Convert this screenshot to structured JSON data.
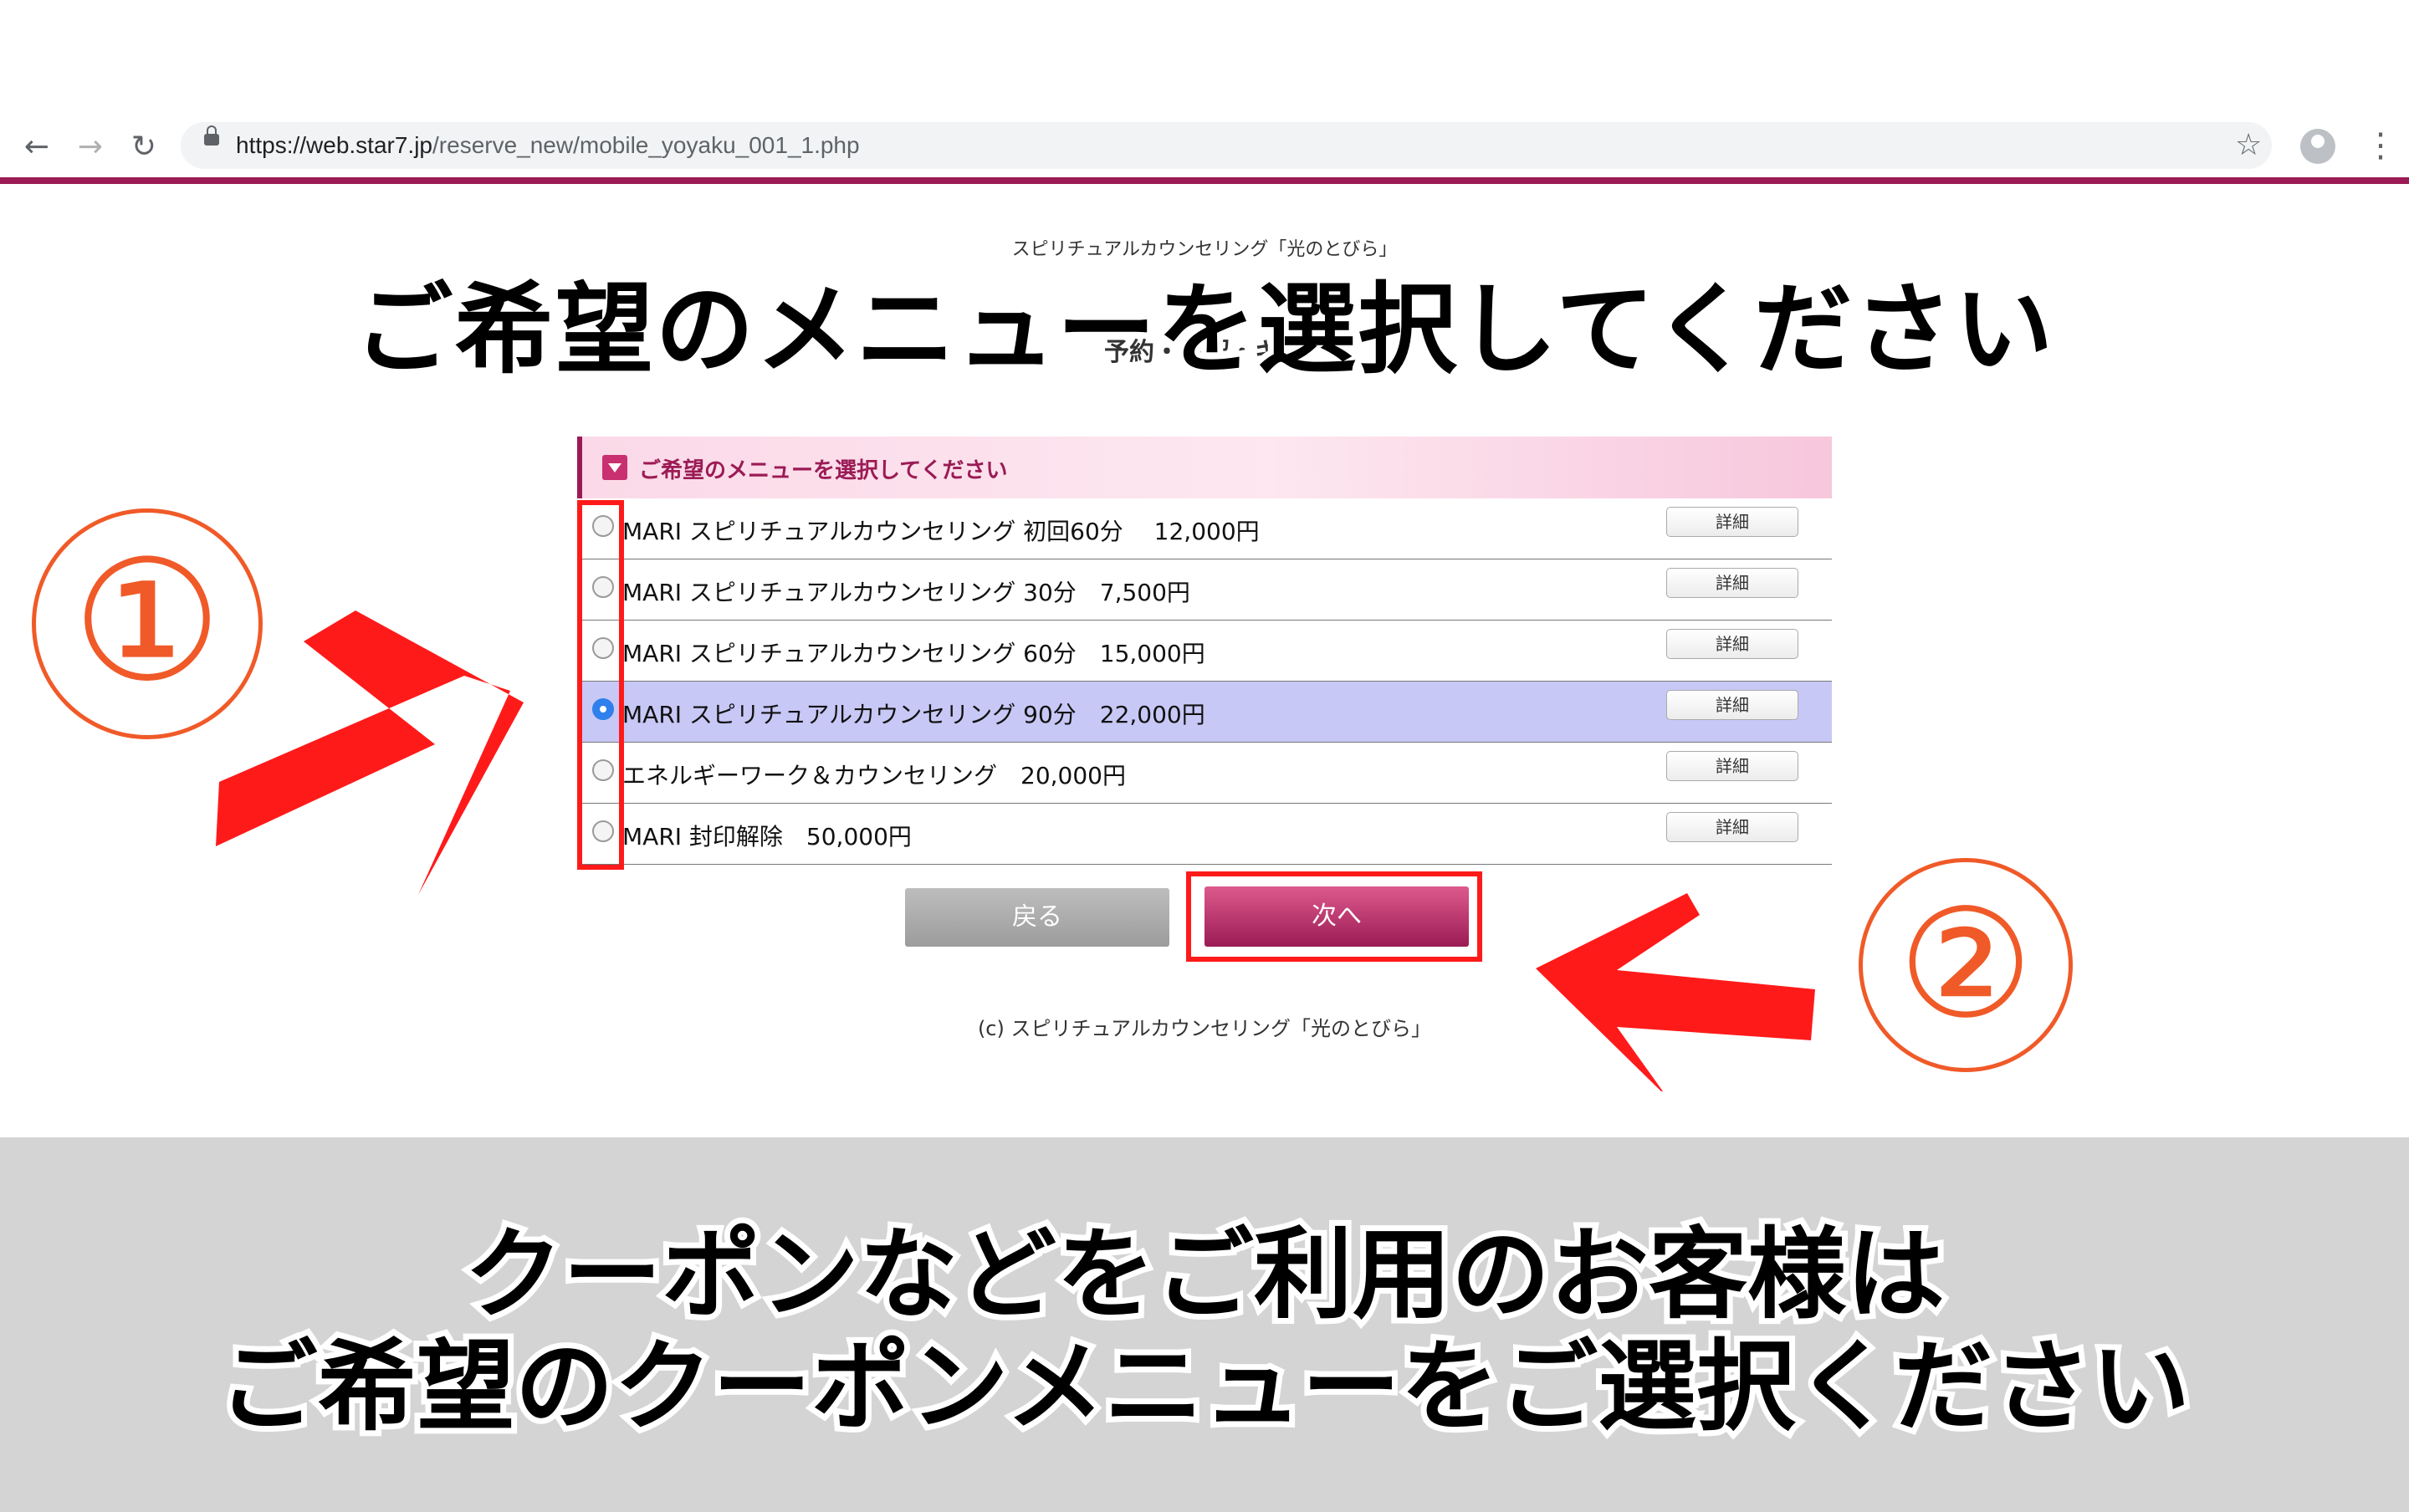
{
  "browser": {
    "url_host": "https://web.star7.jp",
    "url_path": "/reserve_new/mobile_yoyaku_001_1.php",
    "back_icon": "arrow-left-icon",
    "forward_icon": "arrow-right-icon",
    "reload_icon": "reload-icon",
    "bookmark_icon": "star-icon",
    "menu_icon": "kebab-icon",
    "accent_color": "#9b1b55"
  },
  "site": {
    "title": "スピリチュアルカウンセリング「光のとびら」",
    "steps": "予約・確認・キャ"
  },
  "overlay": {
    "title": "ご希望のメニューを選択してください",
    "marker1": "①",
    "marker2": "②"
  },
  "menu": {
    "header": "ご希望のメニューを選択してください",
    "items": [
      {
        "label": "MARI スピリチュアルカウンセリング 初回60分　 12,000円",
        "detail": "詳細",
        "selected": false
      },
      {
        "label": "MARI スピリチュアルカウンセリング 30分　7,500円",
        "detail": "詳細",
        "selected": false
      },
      {
        "label": "MARI スピリチュアルカウンセリング 60分　15,000円",
        "detail": "詳細",
        "selected": false
      },
      {
        "label": "MARI スピリチュアルカウンセリング 90分　22,000円",
        "detail": "詳細",
        "selected": true
      },
      {
        "label": "エネルギーワーク＆カウンセリング　20,000円",
        "detail": "詳細",
        "selected": false
      },
      {
        "label": "MARI 封印解除　50,000円",
        "detail": "詳細",
        "selected": false
      }
    ]
  },
  "buttons": {
    "back": "戻る",
    "next": "次へ"
  },
  "footer": {
    "copyright": "(c)  スピリチュアルカウンセリング「光のとびら」"
  },
  "banner": {
    "line1": "クーポンなどをご利用のお客様は",
    "line2": "ご希望のクーポンメニューをご選択ください"
  }
}
